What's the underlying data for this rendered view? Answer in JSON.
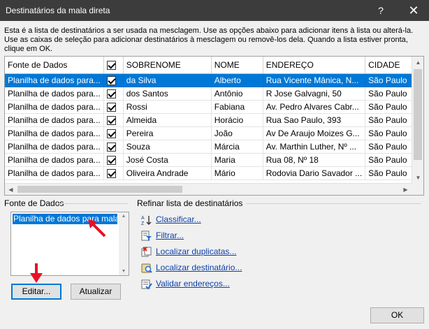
{
  "window": {
    "title": "Destinatários da mala direta",
    "help": "?",
    "close": "✕"
  },
  "description": "Esta é a lista de destinatários a ser usada na mesclagem. Use as opções abaixo para adicionar itens à lista ou alterá-la. Use as caixas de seleção para adicionar destinatários à mesclagem ou removê-los dela. Quando a lista estiver pronta, clique em OK.",
  "grid": {
    "columns": [
      "Fonte de Dados",
      "",
      "SOBRENOME",
      "NOME",
      "ENDEREÇO",
      "CIDADE"
    ],
    "rows": [
      {
        "source": "Planilha de dados para...",
        "checked": true,
        "sobrenome": "da Silva",
        "nome": "Alberto",
        "endereco": "Rua Vicente Mânica, N...",
        "cidade": "São Paulo",
        "selected": true
      },
      {
        "source": "Planilha de dados para...",
        "checked": true,
        "sobrenome": "dos Santos",
        "nome": "Antônio",
        "endereco": "R Jose Galvagni, 50",
        "cidade": "São Paulo",
        "selected": false
      },
      {
        "source": "Planilha de dados para...",
        "checked": true,
        "sobrenome": "Rossi",
        "nome": "Fabiana",
        "endereco": "Av. Pedro Alvares Cabr...",
        "cidade": "São Paulo",
        "selected": false
      },
      {
        "source": "Planilha de dados para...",
        "checked": true,
        "sobrenome": "Almeida",
        "nome": "Horácio",
        "endereco": "Rua Sao Paulo, 393",
        "cidade": "São Paulo",
        "selected": false
      },
      {
        "source": "Planilha de dados para...",
        "checked": true,
        "sobrenome": "Pereira",
        "nome": "João",
        "endereco": "Av De Araujo Moizes G...",
        "cidade": "São Paulo",
        "selected": false
      },
      {
        "source": "Planilha de dados para...",
        "checked": true,
        "sobrenome": "Souza",
        "nome": "Márcia",
        "endereco": "Av. Marthin Luther, Nº ...",
        "cidade": "São Paulo",
        "selected": false
      },
      {
        "source": "Planilha de dados para...",
        "checked": true,
        "sobrenome": "José Costa",
        "nome": "Maria",
        "endereco": "Rua 08, Nº 18",
        "cidade": "São Paulo",
        "selected": false
      },
      {
        "source": "Planilha de dados para...",
        "checked": true,
        "sobrenome": "Oliveira Andrade",
        "nome": "Mário",
        "endereco": "Rodovia Dario Savador ...",
        "cidade": "São Paulo",
        "selected": false
      }
    ]
  },
  "data_source": {
    "label": "Fonte de Dados",
    "item": "Planilha de dados para mala direta",
    "edit_button": "Editar...",
    "refresh_button": "Atualizar"
  },
  "refine": {
    "label": "Refinar lista de destinatários",
    "items": [
      {
        "label": "Classificar...",
        "icon": "sort-icon"
      },
      {
        "label": "Filtrar...",
        "icon": "filter-icon"
      },
      {
        "label": "Localizar duplicatas...",
        "icon": "duplicates-icon"
      },
      {
        "label": "Localizar destinatário...",
        "icon": "find-recipient-icon"
      },
      {
        "label": "Validar endereços...",
        "icon": "validate-addresses-icon"
      }
    ]
  },
  "ok_button": "OK",
  "colors": {
    "selection": "#0078d7",
    "link": "#0d3fa8",
    "arrow": "#e81123",
    "titlebar": "#3c3c3c"
  }
}
